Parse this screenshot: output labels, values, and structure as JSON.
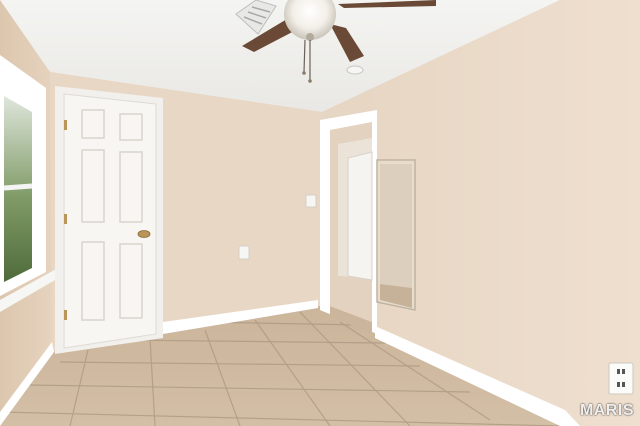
{
  "photo": {
    "watermark": "MARIS",
    "colors": {
      "ceiling": "#f2f2f0",
      "left_wall": "#e5d2bd",
      "back_wall": "#e9d9c6",
      "right_wall": "#eddccb",
      "trim": "#ffffff",
      "floor_tile": "#cdb89e",
      "grout": "#a8957e",
      "fan_blade": "#6a4a36"
    }
  }
}
